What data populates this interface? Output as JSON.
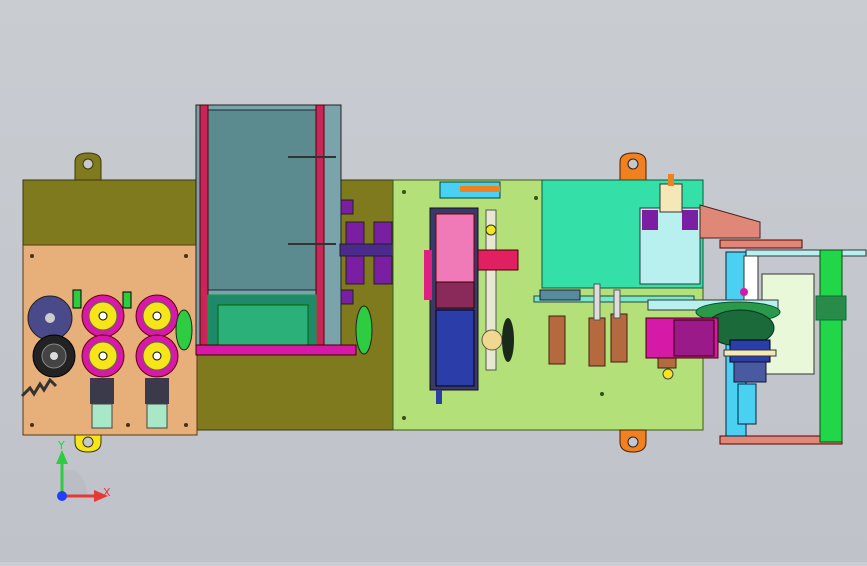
{
  "viewport": {
    "background": "#c5c9ce",
    "model_kind": "machine-assembly-top-view"
  },
  "triad": {
    "x_label": "X",
    "y_label": "Y",
    "x_color": "#e53935",
    "y_color": "#2ecc40",
    "z_color": "#1e40ff"
  },
  "colors": {
    "base_left": "#807a1e",
    "base_right": "#b4e07a",
    "panel_tan": "#e7b07a",
    "hopper": "#5b8a8f",
    "teal_block": "#34e0a8",
    "pink": "#f07ab8",
    "navy": "#2a3da8",
    "green_frame": "#22d64a",
    "magenta": "#d61aa8",
    "bronze": "#b46a3e",
    "yellow": "#f5e51a",
    "cyan": "#4ad0f0",
    "salmon": "#e08878"
  }
}
